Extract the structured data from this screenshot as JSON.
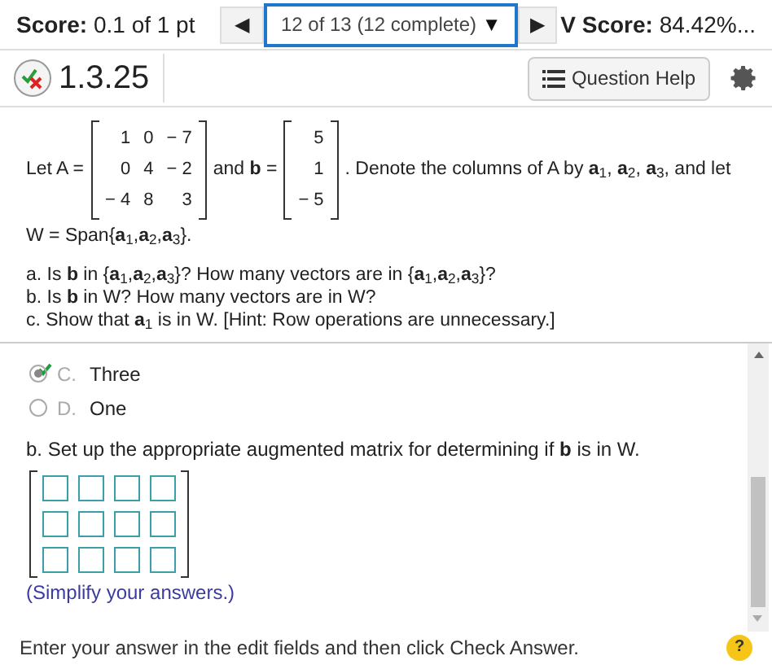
{
  "header": {
    "score_label": "Score:",
    "score_value": "0.1 of 1 pt",
    "prev": "◀",
    "nav": "12 of 13 (12 complete)",
    "nav_caret": "▼",
    "next": "▶",
    "hw_label": "V Score:",
    "hw_value": "84.42%..."
  },
  "question": {
    "number": "1.3.25",
    "help_button": "Question Help"
  },
  "problem": {
    "let_a": "Let A =",
    "matrix_a": [
      [
        "1",
        "0",
        "− 7"
      ],
      [
        "0",
        "4",
        "− 2"
      ],
      [
        "− 4",
        "8",
        "3"
      ]
    ],
    "and_b": "and **b** =",
    "vector_b": [
      "5",
      "1",
      "− 5"
    ],
    "denote": ". Denote the columns of A by **a**$_{1}$, **a**$_{2}$, **a**$_{3}$, and let",
    "span": "W = Span{**a**$_{1}$,**a**$_{2}$,**a**$_{3}$}.",
    "parts": [
      "a. Is **b** in {**a**$_{1}$,**a**$_{2}$,**a**$_{3}$}? How many vectors are in {**a**$_{1}$,**a**$_{2}$,**a**$_{3}$}?",
      "b. Is **b** in W? How many vectors are in W?",
      "c. Show that **a**$_{1}$ is in W. [Hint: Row operations are unnecessary.]"
    ]
  },
  "choices": [
    {
      "letter": "C.",
      "text": "Three",
      "selected": true,
      "correct": true
    },
    {
      "letter": "D.",
      "text": "One",
      "selected": false,
      "correct": false
    }
  ],
  "part_b": {
    "prompt": "b. Set up the appropriate augmented matrix for determining if **b** is in W.",
    "rows": [
      {
        "cells": [
          {
            "kind": "input"
          },
          {
            "kind": "input"
          },
          {
            "kind": "input"
          },
          {
            "kind": "input"
          }
        ]
      },
      {
        "cells": [
          {
            "kind": "input"
          },
          {
            "kind": "input"
          },
          {
            "kind": "input"
          },
          {
            "kind": "input"
          }
        ]
      },
      {
        "cells": [
          {
            "kind": "input"
          },
          {
            "kind": "input"
          },
          {
            "kind": "input"
          },
          {
            "kind": "input"
          }
        ]
      }
    ],
    "note": "(Simplify your answers.)"
  },
  "footer": {
    "instruction": "Enter your answer in the edit fields and then click Check Answer.",
    "help": "?"
  }
}
